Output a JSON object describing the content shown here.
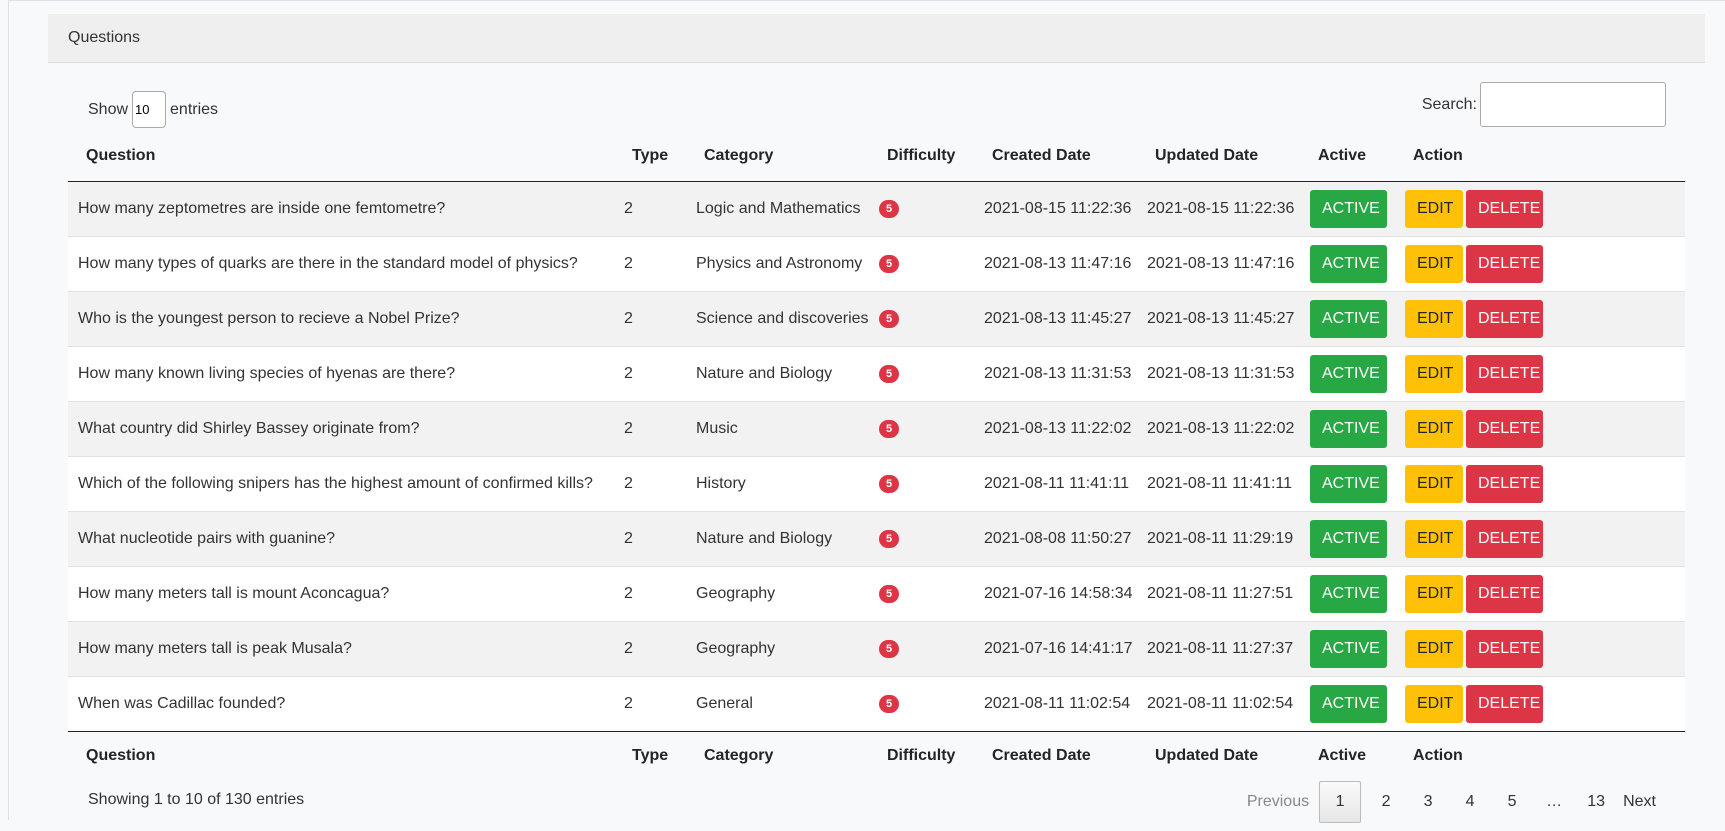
{
  "card": {
    "title": "Questions"
  },
  "length": {
    "show_label": "Show",
    "value": "10",
    "entries_label": "entries"
  },
  "search": {
    "label": "Search:",
    "value": "",
    "placeholder": ""
  },
  "columns": [
    "Question",
    "Type",
    "Category",
    "Difficulty",
    "Created Date",
    "Updated Date",
    "Active",
    "Action"
  ],
  "buttons": {
    "active": "ACTIVE",
    "edit": "EDIT",
    "delete": "DELETE"
  },
  "rows": [
    {
      "question": "How many zeptometres are inside one femtometre?",
      "type": "2",
      "category": "Logic and Mathematics",
      "difficulty": "5",
      "created": "2021-08-15 11:22:36",
      "updated": "2021-08-15 11:22:36"
    },
    {
      "question": "How many types of quarks are there in the standard model of physics?",
      "type": "2",
      "category": "Physics and Astronomy",
      "difficulty": "5",
      "created": "2021-08-13 11:47:16",
      "updated": "2021-08-13 11:47:16"
    },
    {
      "question": "Who is the youngest person to recieve a Nobel Prize?",
      "type": "2",
      "category": "Science and discoveries",
      "difficulty": "5",
      "created": "2021-08-13 11:45:27",
      "updated": "2021-08-13 11:45:27"
    },
    {
      "question": "How many known living species of hyenas are there?",
      "type": "2",
      "category": "Nature and Biology",
      "difficulty": "5",
      "created": "2021-08-13 11:31:53",
      "updated": "2021-08-13 11:31:53"
    },
    {
      "question": "What country did Shirley Bassey originate from?",
      "type": "2",
      "category": "Music",
      "difficulty": "5",
      "created": "2021-08-13 11:22:02",
      "updated": "2021-08-13 11:22:02"
    },
    {
      "question": "Which of the following snipers has the highest amount of confirmed kills?",
      "type": "2",
      "category": "History",
      "difficulty": "5",
      "created": "2021-08-11 11:41:11",
      "updated": "2021-08-11 11:41:11"
    },
    {
      "question": "What nucleotide pairs with guanine?",
      "type": "2",
      "category": "Nature and Biology",
      "difficulty": "5",
      "created": "2021-08-08 11:50:27",
      "updated": "2021-08-11 11:29:19"
    },
    {
      "question": "How many meters tall is mount Aconcagua?",
      "type": "2",
      "category": "Geography",
      "difficulty": "5",
      "created": "2021-07-16 14:58:34",
      "updated": "2021-08-11 11:27:51"
    },
    {
      "question": "How many meters tall is peak Musala?",
      "type": "2",
      "category": "Geography",
      "difficulty": "5",
      "created": "2021-07-16 14:41:17",
      "updated": "2021-08-11 11:27:37"
    },
    {
      "question": "When was Cadillac founded?",
      "type": "2",
      "category": "General",
      "difficulty": "5",
      "created": "2021-08-11 11:02:54",
      "updated": "2021-08-11 11:02:54"
    }
  ],
  "info": "Showing 1 to 10 of 130 entries",
  "pagination": {
    "previous": "Previous",
    "pages": [
      "1",
      "2",
      "3",
      "4",
      "5",
      "…",
      "13"
    ],
    "current": "1",
    "next": "Next"
  },
  "colors": {
    "active": "#28a745",
    "edit": "#ffc107",
    "delete": "#dc3545",
    "badge": "#dc3545"
  }
}
